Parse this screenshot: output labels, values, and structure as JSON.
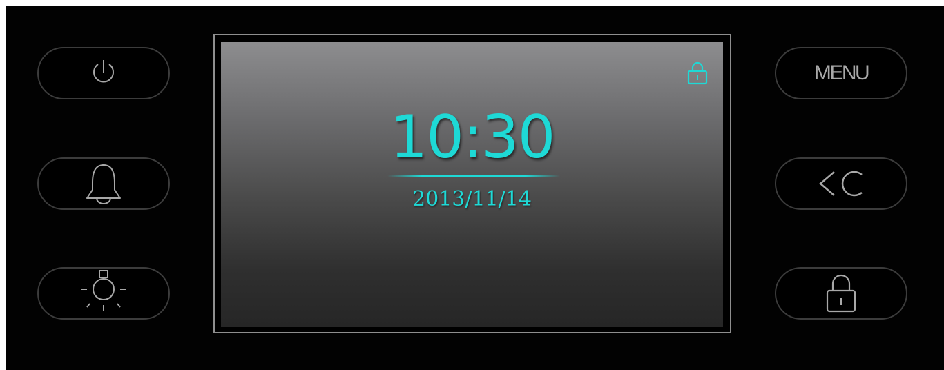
{
  "display": {
    "time": "10:30",
    "date": "2013/11/14",
    "status_icon": "lock-icon"
  },
  "buttons": {
    "left": [
      {
        "name": "power-button",
        "icon": "power-icon"
      },
      {
        "name": "alarm-button",
        "icon": "bell-icon"
      },
      {
        "name": "light-button",
        "icon": "light-bulb-icon"
      }
    ],
    "right": [
      {
        "name": "menu-button",
        "label": "MENU"
      },
      {
        "name": "back-button",
        "icon": "back-arrow-icon"
      },
      {
        "name": "lock-button",
        "icon": "lock-icon"
      }
    ],
    "menu_label": "MENU"
  },
  "colors": {
    "accent": "#1ed9d6",
    "button_outline": "#3c3c3c",
    "button_icon": "#a8a8a8",
    "panel_background": "#020202"
  }
}
